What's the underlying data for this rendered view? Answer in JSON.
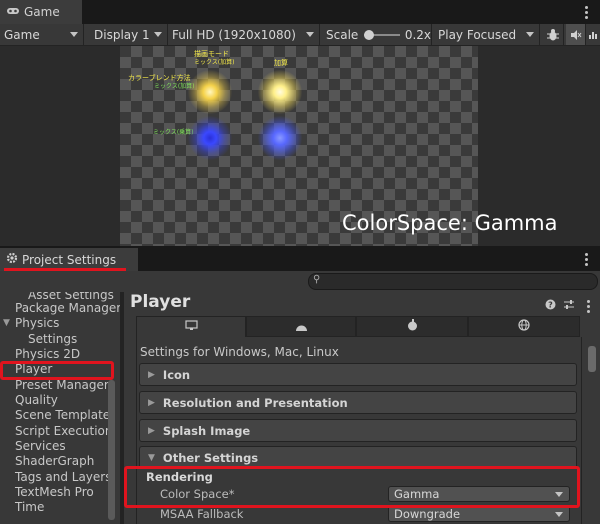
{
  "game_window": {
    "tab_label": "Game",
    "toolbar": {
      "view_mode": "Game",
      "display": "Display 1",
      "resolution": "Full HD (1920x1080)",
      "scale_label": "Scale",
      "scale_value": "0.2x",
      "play_mode": "Play Focused"
    },
    "scene": {
      "label_blend_mode": "描画モード",
      "label_mix_add": "ミックス(加算)",
      "label_add": "加算",
      "label_blend_method": "カラーブレンド方法",
      "label_mix_add_2": "ミックス(加算)",
      "label_mix_multiply": "ミックス(乗算)",
      "caption": "ColorSpace: Gamma",
      "glow_yellow": "#f5d24a",
      "glow_blue": "#3a48ff"
    }
  },
  "project_settings": {
    "tab_label": "Project Settings",
    "sidebar": {
      "items": [
        "Asset Settings",
        "Package Manager",
        "Physics",
        "Settings",
        "Physics 2D",
        "Player",
        "Preset Manager",
        "Quality",
        "Scene Template",
        "Script Execution",
        "Services",
        "ShaderGraph",
        "Tags and Layers",
        "TextMesh Pro",
        "Time"
      ],
      "selected": "Player"
    },
    "main": {
      "title": "Player",
      "platform_tabs": [
        "desktop-icon",
        "android-icon",
        "apple-icon",
        "webgl-icon"
      ],
      "platform_text": "Settings for Windows, Mac, Linux",
      "sections": [
        "Icon",
        "Resolution and Presentation",
        "Splash Image",
        "Other Settings"
      ],
      "rendering_label": "Rendering",
      "color_space_label": "Color Space*",
      "color_space_value": "Gamma",
      "msaa_label": "MSAA Fallback",
      "msaa_value": "Downgrade"
    },
    "highlight_color": "#e0141e"
  }
}
